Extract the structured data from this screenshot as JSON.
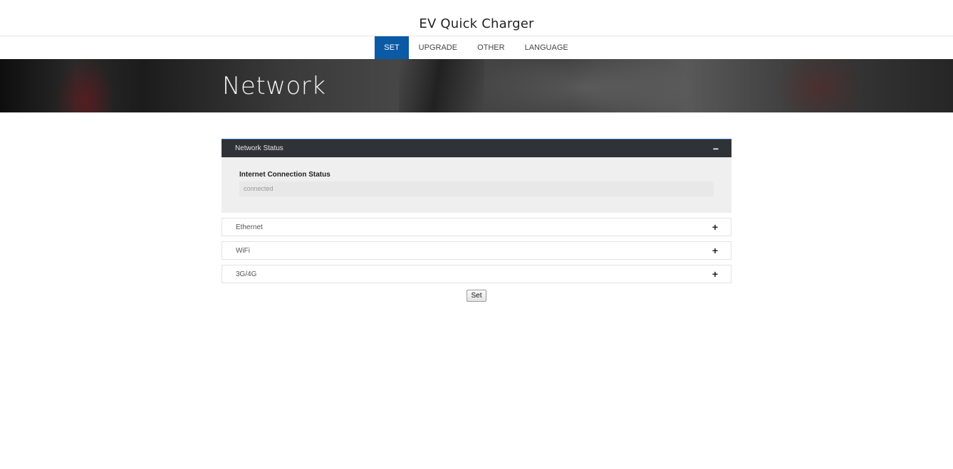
{
  "header": {
    "title": "EV Quick Charger"
  },
  "nav": {
    "items": [
      {
        "label": "SET",
        "active": true
      },
      {
        "label": "UPGRADE",
        "active": false
      },
      {
        "label": "OTHER",
        "active": false
      },
      {
        "label": "LANGUAGE",
        "active": false
      }
    ]
  },
  "hero": {
    "title": "Network"
  },
  "panels": {
    "network_status": {
      "title": "Network Status",
      "expanded": true,
      "toggle": "−",
      "field_label": "Internet Connection Status",
      "field_value": "connected"
    },
    "ethernet": {
      "title": "Ethernet",
      "expanded": false,
      "toggle": "+"
    },
    "wifi": {
      "title": "WiFi",
      "expanded": false,
      "toggle": "+"
    },
    "cellular": {
      "title": "3G/4G",
      "expanded": false,
      "toggle": "+"
    }
  },
  "actions": {
    "set_label": "Set"
  },
  "colors": {
    "accent": "#0a5aa6",
    "panel_header_dark": "#2f3236",
    "panel_body": "#efefef"
  }
}
